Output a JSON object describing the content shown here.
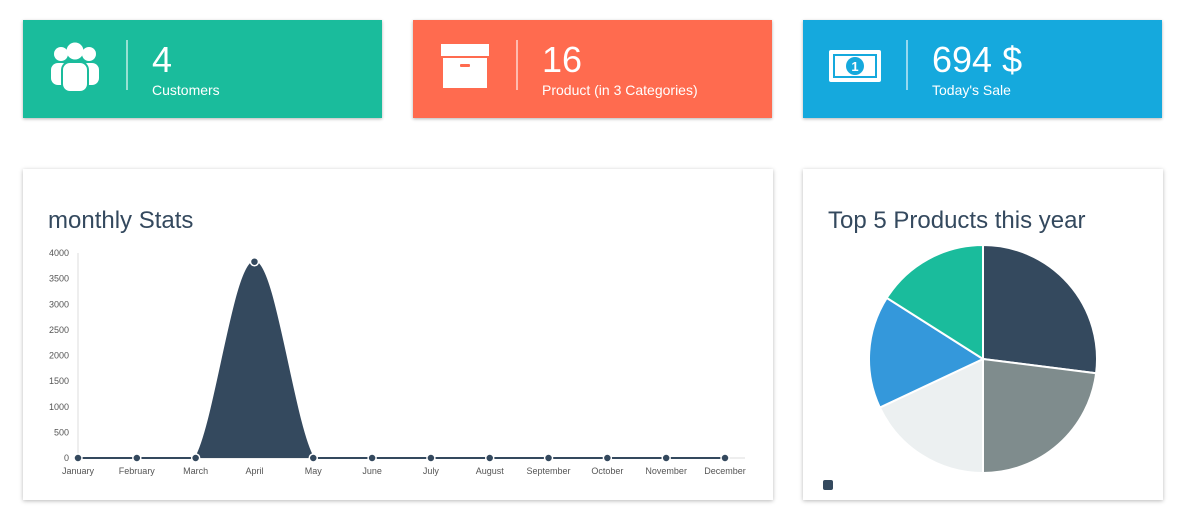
{
  "stats": {
    "customers": {
      "value": "4",
      "label": "Customers",
      "color": "#1abc9c",
      "icon": "users-icon"
    },
    "products": {
      "value": "16",
      "label": "Product (in 3 Categories)",
      "color": "#ff6b4f",
      "icon": "archive-box-icon"
    },
    "sales": {
      "value": "694 $",
      "label": "Today's Sale",
      "color": "#15a9dd",
      "icon": "money-bill-icon"
    }
  },
  "monthly": {
    "title": "monthly Stats",
    "chart_data": {
      "type": "area",
      "categories": [
        "January",
        "February",
        "March",
        "April",
        "May",
        "June",
        "July",
        "August",
        "September",
        "October",
        "November",
        "December"
      ],
      "values": [
        0,
        0,
        0,
        3830,
        0,
        0,
        0,
        0,
        0,
        0,
        0,
        0
      ],
      "y_ticks": [
        0,
        500,
        1000,
        1500,
        2000,
        2500,
        3000,
        3500,
        4000
      ],
      "ylim": [
        0,
        4000
      ],
      "color": "#34495e",
      "grid": false
    }
  },
  "top_products": {
    "title": "Top 5 Products this year",
    "chart_data": {
      "type": "pie",
      "values": [
        27,
        23,
        18,
        16,
        16
      ],
      "colors": [
        "#34495e",
        "#7f8c8d",
        "#ecf0f1",
        "#3498db",
        "#1abc9c"
      ],
      "legend_color": "#34495e"
    }
  }
}
